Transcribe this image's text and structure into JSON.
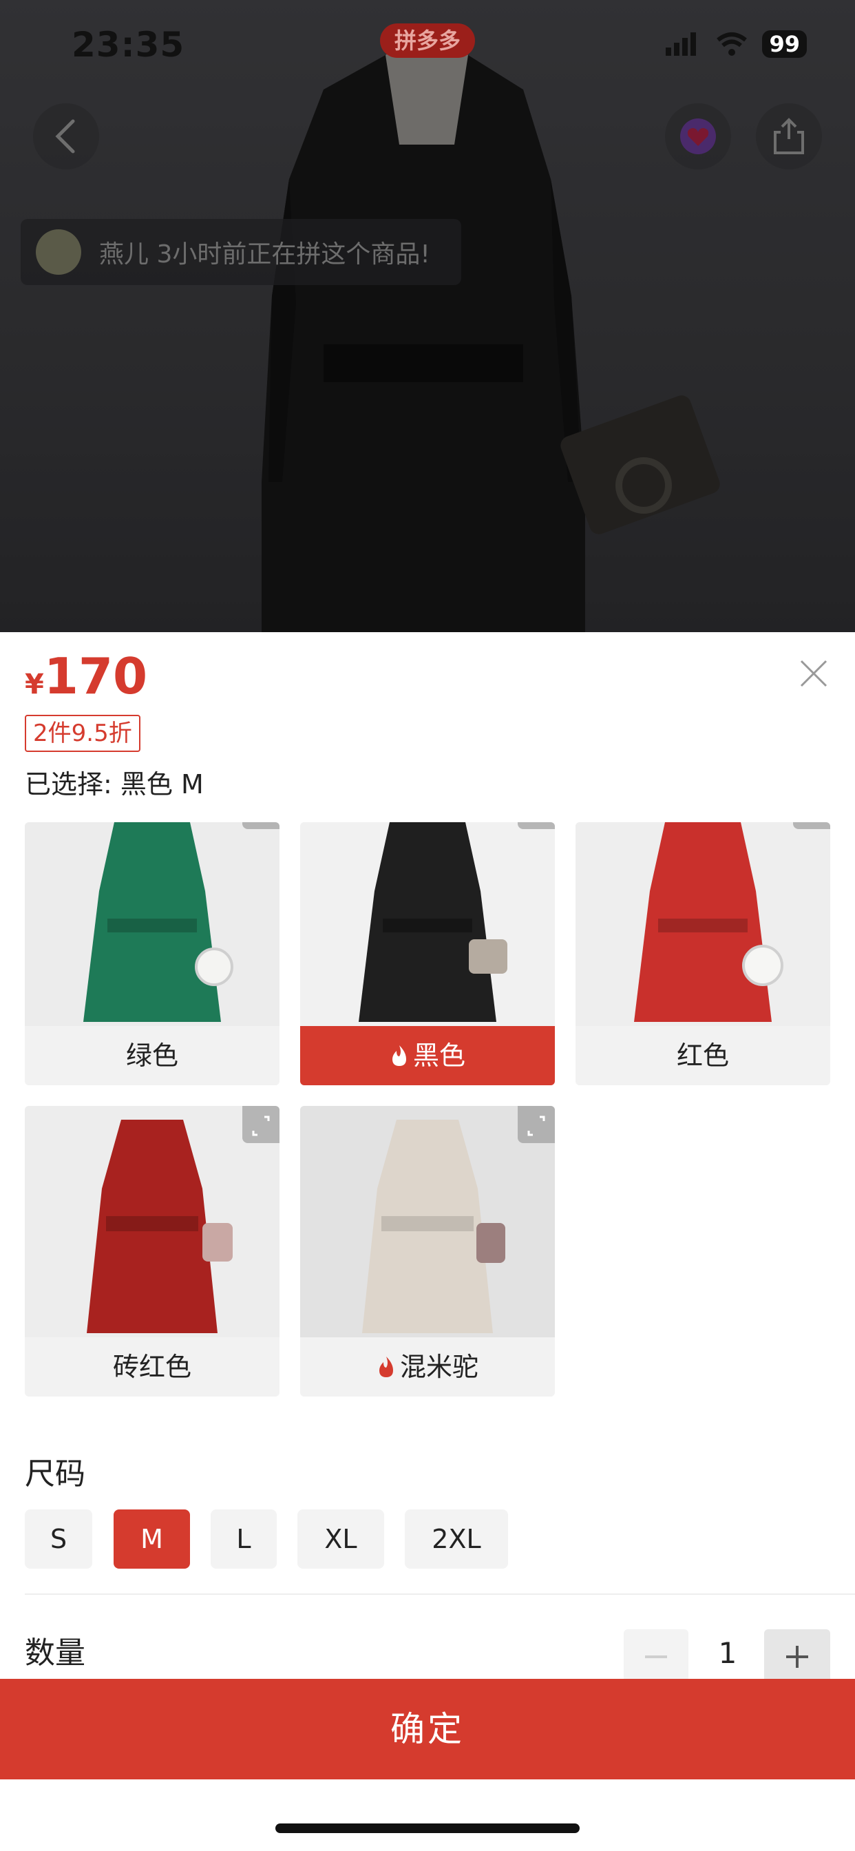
{
  "status_bar": {
    "time": "23:35",
    "battery": "99",
    "app_badge": "拼多多"
  },
  "hero": {
    "group_toast": "燕儿 3小时前正在拼这个商品!",
    "icons": [
      "back-icon",
      "kefu-heart-icon",
      "share-icon"
    ]
  },
  "sheet": {
    "price_currency": "¥",
    "price_value": "170",
    "discount_tag": "2件9.5折",
    "selected_text": "已选择: 黑色 M",
    "colors": [
      {
        "label": "绿色",
        "coat_color": "#1e7a57",
        "hot": false,
        "active": false
      },
      {
        "label": "黑色",
        "coat_color": "#1f1f1f",
        "hot": true,
        "active": true
      },
      {
        "label": "红色",
        "coat_color": "#c9302c",
        "hot": false,
        "active": false
      },
      {
        "label": "砖红色",
        "coat_color": "#a8221f",
        "hot": false,
        "active": false
      },
      {
        "label": "混米驼",
        "coat_color": "#ddd5cb",
        "hot": true,
        "active": false
      }
    ],
    "size_title": "尺码",
    "sizes": [
      {
        "label": "S",
        "active": false
      },
      {
        "label": "M",
        "active": true
      },
      {
        "label": "L",
        "active": false
      },
      {
        "label": "XL",
        "active": false
      },
      {
        "label": "2XL",
        "active": false
      }
    ],
    "qty_title": "数量",
    "qty_value": "1",
    "confirm_label": "确定"
  },
  "colors": {
    "accent": "#d53b2e",
    "chip_bg": "#f3f3f3"
  }
}
